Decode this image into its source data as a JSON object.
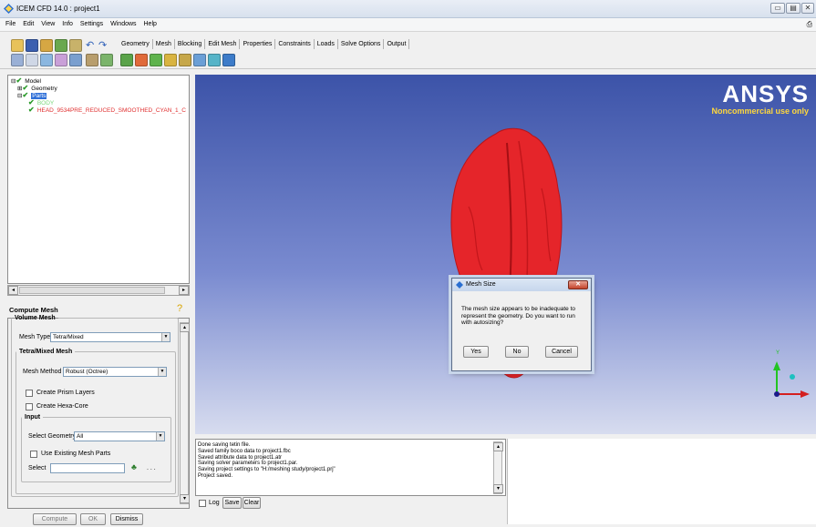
{
  "window": {
    "title": "ICEM CFD 14.0 : project1",
    "controls": [
      "minimize",
      "restore",
      "close"
    ]
  },
  "menu": [
    "File",
    "Edit",
    "View",
    "Info",
    "Settings",
    "Windows",
    "Help"
  ],
  "tabs": [
    "Geometry",
    "Mesh",
    "Blocking",
    "Edit Mesh",
    "Properties",
    "Constraints",
    "Loads",
    "Solve Options",
    "Output"
  ],
  "tree": {
    "model": "Model",
    "geometry": "Geometry",
    "parts": "Parts",
    "body": "BODY",
    "head": "HEAD_9534PRE_REDUCED_SMOOTHED_CYAN_1_C"
  },
  "compute": {
    "header": "Compute Mesh",
    "volume_mesh_legend": "Volume Mesh",
    "mesh_type_label": "Mesh Type",
    "mesh_type_value": "Tetra/Mixed",
    "tetra_legend": "Tetra/Mixed Mesh",
    "mesh_method_label": "Mesh Method",
    "mesh_method_value": "Robust (Octree)",
    "create_prism": "Create Prism Layers",
    "create_hexa": "Create Hexa-Core",
    "input_legend": "Input",
    "select_geometry_label": "Select Geometry",
    "select_geometry_value": "All",
    "use_existing": "Use Existing Mesh Parts",
    "select_label": "Select",
    "ellipsis": ". . .",
    "compute_btn": "Compute",
    "ok_btn": "OK",
    "dismiss_btn": "Dismiss"
  },
  "viewport": {
    "brand": "ANSYS",
    "license_note": "Noncommercial use only",
    "axis_y": "Y"
  },
  "dialog": {
    "title": "Mesh Size",
    "message": "The mesh size appears to be inadequate to represent the geometry. Do you want to run with autosizing?",
    "yes": "Yes",
    "no": "No",
    "cancel": "Cancel"
  },
  "log": {
    "lines": [
      "Done saving tetin file.",
      "Saved family boco data to project1.fbc",
      "Saved attribute data to project1.atr",
      "Saving solver parameters to project1.par.",
      "Saving project settings to \"H:/meshing study/project1.prj\"",
      "Project saved."
    ],
    "log_checkbox": "Log",
    "save_btn": "Save",
    "clear_btn": "Clear"
  }
}
